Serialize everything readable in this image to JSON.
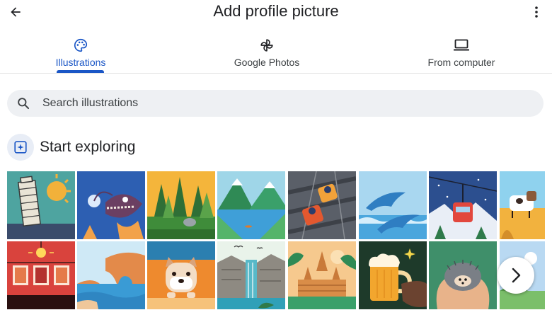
{
  "header": {
    "title": "Add profile picture",
    "back_icon": "arrow-back-icon",
    "more_icon": "more-vert-icon"
  },
  "tabs": [
    {
      "label": "Illustrations",
      "icon": "palette-icon",
      "active": true
    },
    {
      "label": "Google Photos",
      "icon": "pinwheel-icon",
      "active": false
    },
    {
      "label": "From computer",
      "icon": "laptop-icon",
      "active": false
    }
  ],
  "search": {
    "placeholder": "Search illustrations",
    "value": "",
    "icon": "search-icon"
  },
  "section": {
    "title": "Start exploring",
    "icon": "sparkle-frame-icon"
  },
  "gallery": {
    "row1": [
      "leaning-tower",
      "anglerfish",
      "forest-with-fox",
      "mountain-lake-kayak",
      "roller-coaster",
      "dolphins",
      "cable-car",
      "cow-field"
    ],
    "row2": [
      "lightbulb-photos",
      "coastal-cliffs",
      "dog-face",
      "waterfall",
      "temple",
      "beer-mug",
      "hedgehog-in-hands",
      "blue-illustration"
    ],
    "next_icon": "chevron-right-icon"
  },
  "colors": {
    "accent": "#1a56c6",
    "search_bg": "#eef0f3",
    "section_icon_bg": "#e8edf6"
  }
}
